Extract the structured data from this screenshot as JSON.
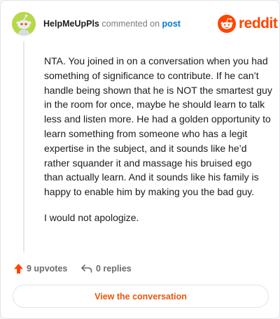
{
  "comment": {
    "username": "HelpMeUpPls",
    "action_text": "commented on",
    "post_link": "post",
    "paragraphs": [
      "NTA. You joined in on a conversation when you had something of significance to contribute. If he can’t handle being shown that he is NOT the smartest guy in the room for once, maybe he should learn to talk less and listen more. He had a golden opportunity to learn something from someone who has a legit expertise in the subject, and it sounds like he’d rather squander it and massage his bruised ego than actually learn. And it sounds like his family is happy to enable him by making you the bad guy.",
      "I would not apologize."
    ],
    "upvotes_label": "9 upvotes",
    "replies_label": "0 replies",
    "view_button": "View the conversation"
  },
  "brand": {
    "logo_text": "reddit",
    "logo_icon": "reddit-snoo-icon",
    "accent_color": "#ff4500",
    "link_color": "#0079d3"
  },
  "icons": {
    "upvote": "upvote-arrow-icon",
    "reply": "reply-arrow-icon",
    "avatar": "snoo-avatar-icon"
  }
}
